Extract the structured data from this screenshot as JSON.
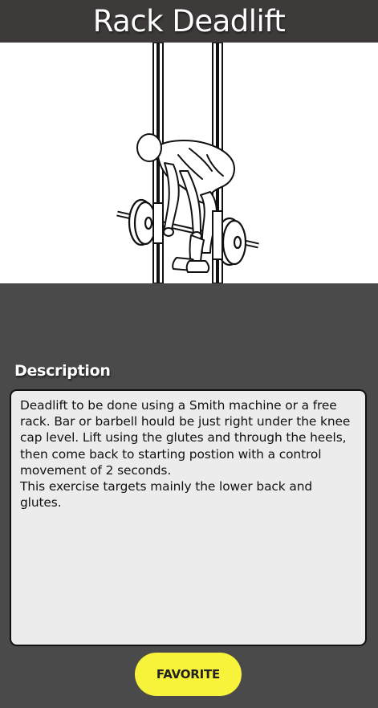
{
  "header": {
    "title": "Rack Deadlift"
  },
  "exercise": {
    "image_icon": "rack-deadlift-illustration"
  },
  "description": {
    "heading": "Description",
    "text": "Deadlift to be done using a Smith machine or a free rack. Bar or barbell hould be just right under the knee cap level. Lift using the glutes and through the heels, then come back to starting postion with a control movement of 2 seconds.\nThis exercise targets mainly the lower back and glutes."
  },
  "actions": {
    "favorite_label": "FAVORITE"
  },
  "colors": {
    "background": "#4a4a4a",
    "title_bar": "#3e3a3a",
    "description_box": "#ececec",
    "favorite_button": "#f7f23a"
  }
}
